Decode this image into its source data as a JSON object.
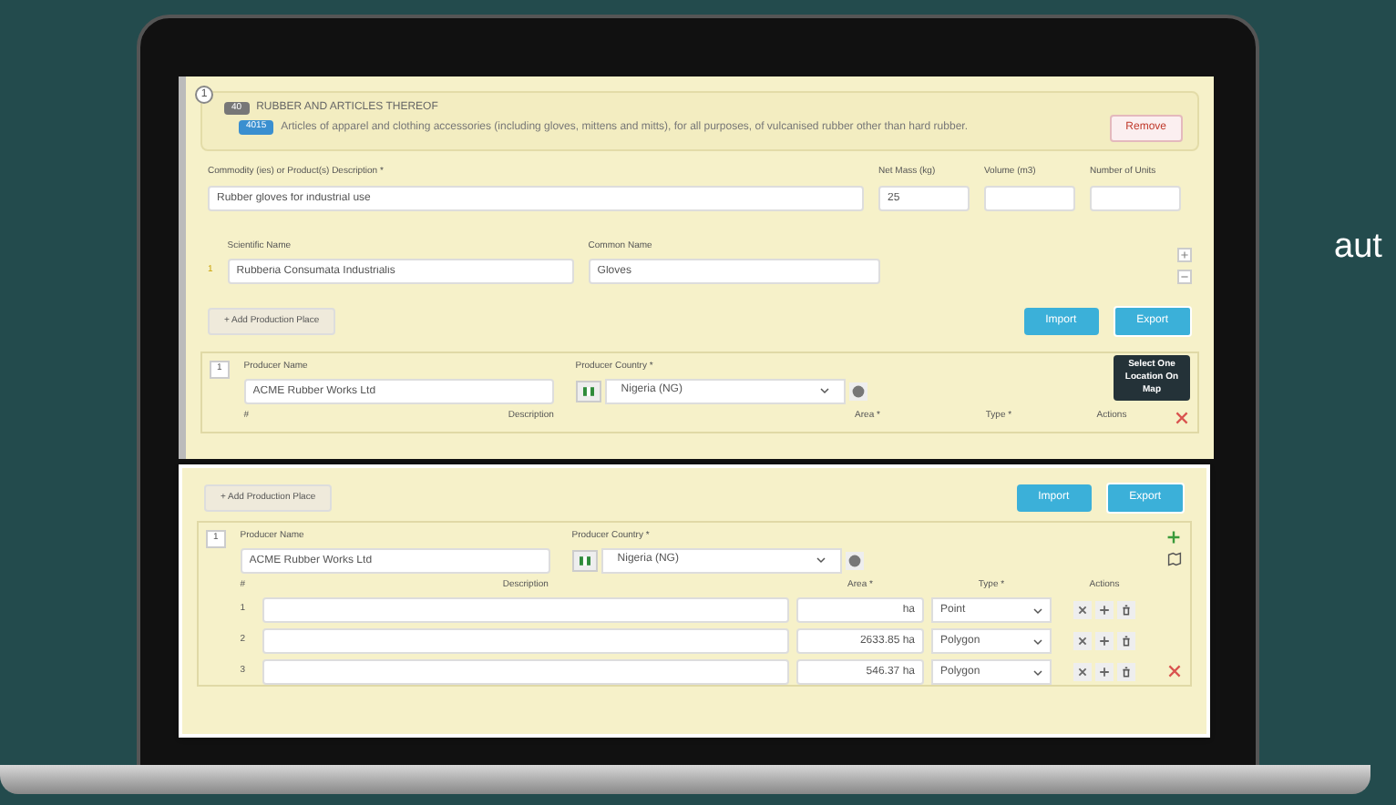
{
  "side_text": "aut",
  "top": {
    "item_number": "1",
    "chapter_code": "40",
    "chapter_title": "RUBBER AND ARTICLES THEREOF",
    "heading_code": "4015",
    "heading_text": "Articles of apparel and clothing accessories (including gloves, mittens and mitts), for all purposes, of vulcanised rubber other than hard rubber.",
    "remove_button": "Remove",
    "fields": [
      {
        "label": "Commodity (ies) or Product(s) Description *",
        "value": "Rubber gloves for industrial use",
        "kind": "wide"
      },
      {
        "label": "Net Mass (kg)",
        "value": "25",
        "kind": "narrow"
      },
      {
        "label": "Volume (m3)",
        "kind": "narrow"
      },
      {
        "label": "Number of Units",
        "kind": "narrow"
      }
    ],
    "species": {
      "scientific_label": "Scientific Name",
      "common_label": "Common Name",
      "number": "1",
      "scientific": "Rubberia Consumata Industrialis",
      "common": "Gloves"
    },
    "production": {
      "add_button": "+ Add Production Place",
      "import_button": "Import",
      "export_button": "Export",
      "number": "1",
      "producer_label": "Producer Name",
      "country_label": "Producer Country *",
      "producer": "ACME Rubber Works Ltd",
      "country": "Nigeria (NG)",
      "tooltip": "Select One Location On Map",
      "columns": [
        "#",
        "Description",
        "Area *",
        "Type *",
        "Actions"
      ]
    }
  },
  "overlay": {
    "add_button": "+ Add Production Place",
    "import_button": "Import",
    "export_button": "Export",
    "number": "1",
    "producer_label": "Producer Name",
    "country_label": "Producer Country *",
    "producer": "ACME Rubber Works Ltd",
    "country": "Nigeria (NG)",
    "columns": [
      "#",
      "Description",
      "Area *",
      "Type *",
      "Actions"
    ],
    "rows": [
      {
        "number": "1",
        "area": "ha",
        "type": "Point"
      },
      {
        "number": "2",
        "area": "2633.85 ha",
        "type": "Polygon"
      },
      {
        "number": "3",
        "area": "546.37 ha",
        "type": "Polygon"
      }
    ]
  }
}
